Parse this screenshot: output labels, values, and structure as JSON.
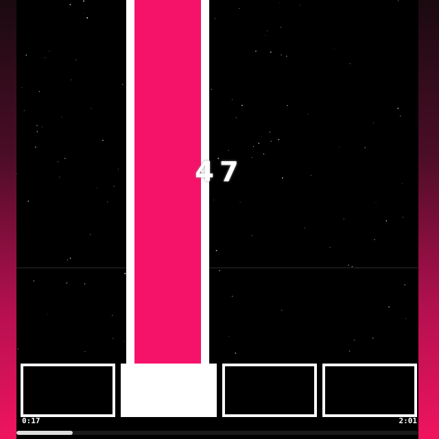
{
  "combo": "47",
  "timer": {
    "elapsed": "0:17",
    "total": "2:01",
    "progress": 0.14
  },
  "lanes": [
    {
      "lane": 1,
      "pressed": false
    },
    {
      "lane": 2,
      "pressed": true
    },
    {
      "lane": 3,
      "pressed": false
    },
    {
      "lane": 4,
      "pressed": false
    }
  ],
  "falling_note": {
    "lane": 2,
    "color": "#f5136a"
  },
  "colors": {
    "accent": "#f5136a",
    "background": "#000000",
    "tile_border": "#ffffff"
  }
}
